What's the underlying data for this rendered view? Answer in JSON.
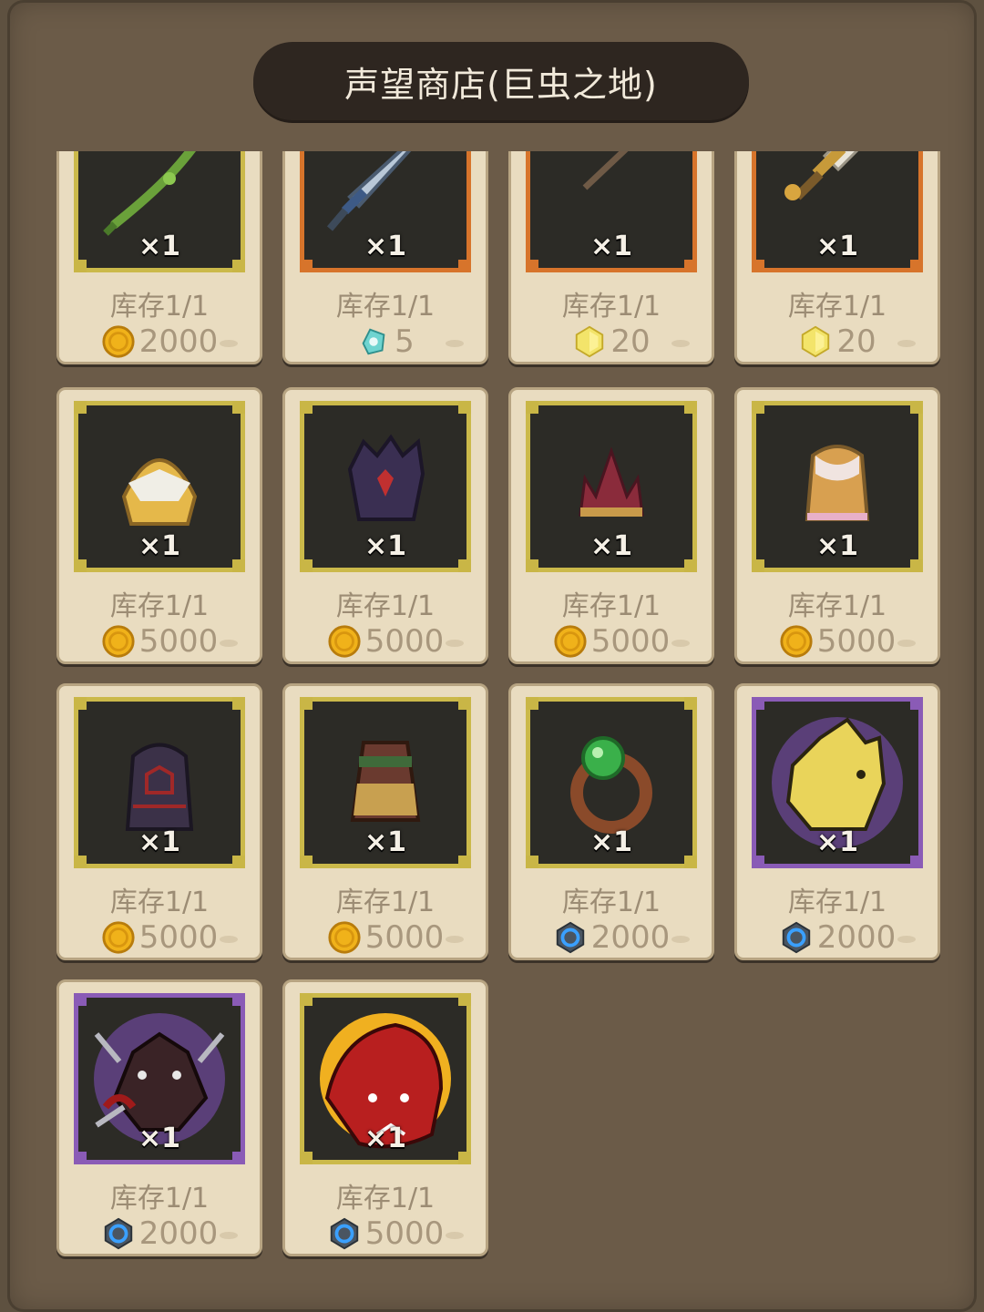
{
  "shop": {
    "title": "声望商店(巨虫之地)"
  },
  "items": [
    {
      "quantity": "×1",
      "stock": "库存1/1",
      "price": "2000",
      "currency_icon": "gold-coin-icon",
      "rarity": "yellow",
      "art": "vine-bow"
    },
    {
      "quantity": "×1",
      "stock": "库存1/1",
      "price": "5",
      "currency_icon": "crystal-shard-icon",
      "rarity": "orange",
      "art": "sword"
    },
    {
      "quantity": "×1",
      "stock": "库存1/1",
      "price": "20",
      "currency_icon": "gold-gem-icon",
      "rarity": "orange",
      "art": "staff"
    },
    {
      "quantity": "×1",
      "stock": "库存1/1",
      "price": "20",
      "currency_icon": "gold-gem-icon",
      "rarity": "orange",
      "art": "greatsword"
    },
    {
      "quantity": "×1",
      "stock": "库存1/1",
      "price": "5000",
      "currency_icon": "gold-coin-icon",
      "rarity": "yellow",
      "art": "gold-helmet"
    },
    {
      "quantity": "×1",
      "stock": "库存1/1",
      "price": "5000",
      "currency_icon": "gold-coin-icon",
      "rarity": "yellow",
      "art": "spiked-helmet"
    },
    {
      "quantity": "×1",
      "stock": "库存1/1",
      "price": "5000",
      "currency_icon": "gold-coin-icon",
      "rarity": "yellow",
      "art": "crown"
    },
    {
      "quantity": "×1",
      "stock": "库存1/1",
      "price": "5000",
      "currency_icon": "gold-coin-icon",
      "rarity": "yellow",
      "art": "robe"
    },
    {
      "quantity": "×1",
      "stock": "库存1/1",
      "price": "5000",
      "currency_icon": "gold-coin-icon",
      "rarity": "yellow",
      "art": "dark-armor"
    },
    {
      "quantity": "×1",
      "stock": "库存1/1",
      "price": "5000",
      "currency_icon": "gold-coin-icon",
      "rarity": "yellow",
      "art": "skirt"
    },
    {
      "quantity": "×1",
      "stock": "库存1/1",
      "price": "2000",
      "currency_icon": "blue-rune-icon",
      "rarity": "yellow",
      "art": "emerald-ring"
    },
    {
      "quantity": "×1",
      "stock": "库存1/1",
      "price": "2000",
      "currency_icon": "blue-rune-icon",
      "rarity": "purple",
      "art": "yellow-beast"
    },
    {
      "quantity": "×1",
      "stock": "库存1/1",
      "price": "2000",
      "currency_icon": "blue-rune-icon",
      "rarity": "purple",
      "art": "dark-spider"
    },
    {
      "quantity": "×1",
      "stock": "库存1/1",
      "price": "5000",
      "currency_icon": "blue-rune-icon",
      "rarity": "yellow",
      "art": "red-worm"
    }
  ],
  "colors": {
    "rarity_yellow": "#cbb94a",
    "rarity_orange": "#d7742b",
    "rarity_purple": "#8a5bb6"
  }
}
